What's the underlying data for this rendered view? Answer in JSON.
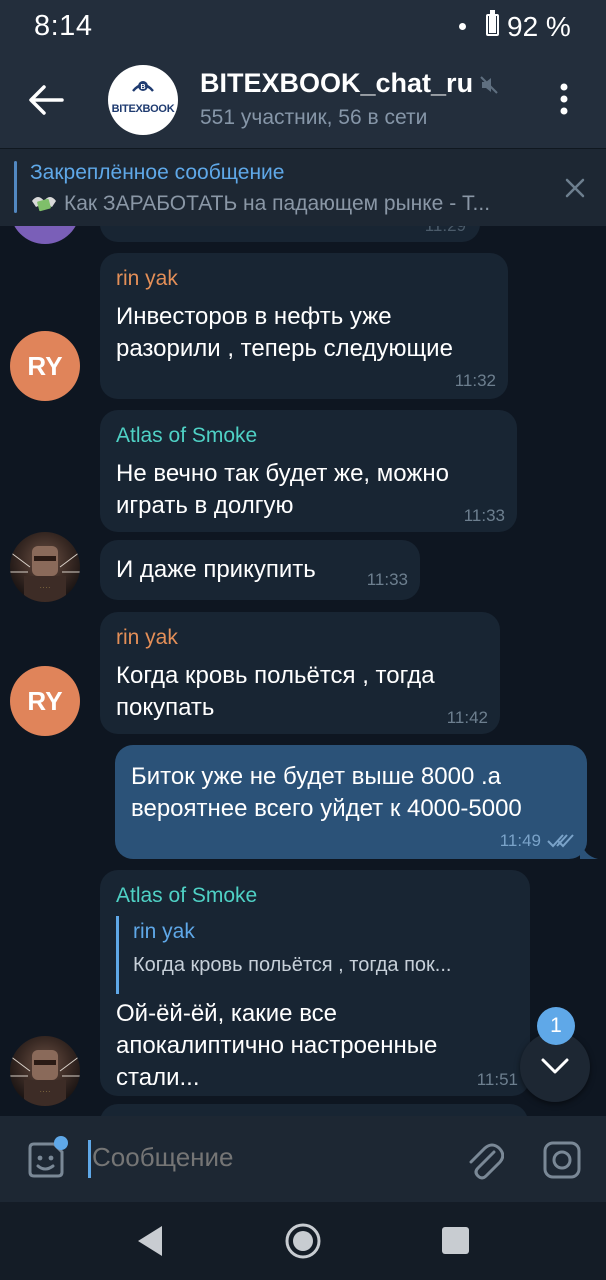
{
  "status_bar": {
    "time": "8:14",
    "battery": "92 %",
    "battery_level": 0.92
  },
  "header": {
    "title": "BITEXBOOK_chat_ru",
    "subtitle": "551 участник, 56 в сети",
    "avatar_logo_text": "BITEXBOOK",
    "muted": true
  },
  "pinned": {
    "title": "Закреплённое сообщение",
    "text": "Как ЗАРАБОТАТЬ на падающем рынке - Т..."
  },
  "messages": [
    {
      "id": "m1",
      "sender": "rin yak",
      "sender_color": "#e48f58",
      "lines": [
        "Инвесторов в нефть уже",
        "разорили , теперь следующие"
      ],
      "time": "11:32",
      "avatar": "RY"
    },
    {
      "id": "m2",
      "sender": "Atlas of Smoke",
      "sender_color": "#4fd1c5",
      "lines": [
        "Не вечно так будет же, можно",
        "играть в долгую"
      ],
      "time": "11:33"
    },
    {
      "id": "m3",
      "lines": [
        "И даже прикупить"
      ],
      "time": "11:33"
    },
    {
      "id": "m4",
      "sender": "rin yak",
      "sender_color": "#e48f58",
      "lines": [
        "Когда кровь польётся , тогда",
        "покупать"
      ],
      "time": "11:42",
      "avatar": "RY"
    },
    {
      "id": "m5",
      "outgoing": true,
      "lines": [
        "Биток уже не будет выше 8000 .а",
        "вероятнее всего уйдет к 4000-5000"
      ],
      "time": "11:49",
      "read": true
    },
    {
      "id": "m6",
      "sender": "Atlas of Smoke",
      "sender_color": "#4fd1c5",
      "reply": {
        "name": "rin yak",
        "text": "Когда кровь польётся , тогда пок..."
      },
      "lines": [
        "Ой-ёй-ёй, какие все",
        "апокалиптично настроенные",
        "стали..."
      ],
      "time": "11:51"
    }
  ],
  "partial_message_time": "11:29",
  "scroll_fab": {
    "badge": "1"
  },
  "input": {
    "placeholder": "Сообщение"
  },
  "colors": {
    "accent": "#5fa8e8",
    "bg": "#0e1621",
    "bubble_in": "#182533",
    "bubble_out": "#2b5278"
  }
}
